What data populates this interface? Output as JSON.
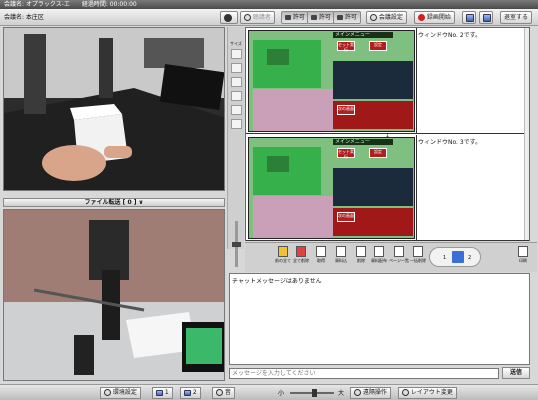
{
  "titlebar": {
    "meeting_label": "会議名: オプラックス-エ",
    "elapsed_label": "経過時間: 00:00:00"
  },
  "toolbar": {
    "meeting_name": "会議名: 本庄区",
    "audience_label": "聴講者",
    "permit1_label": "許可",
    "permit2_label": "許可",
    "permit3_label": "許可",
    "settings_label": "会議設定",
    "record_label": "録画開始",
    "exit_label": "退室する"
  },
  "file_transfer": {
    "label": "ファイル転送 [ 0 ] ∨"
  },
  "document": {
    "caption1": "ウィンドウNo. 2です。",
    "caption2": "ウィンドウNo. 3です。",
    "page_divider": "1",
    "mini_title": "メインメニュー",
    "mini_btn1": "セット実行",
    "mini_btn2": "設定",
    "mini_btn3": "次の画面"
  },
  "doc_tools": {
    "prev_all": "前の全て",
    "delete_all": "全て削除",
    "tool1": "取得",
    "tool2": "資料込",
    "tool3": "削除",
    "tool4": "資料配布",
    "tool5": "ページ一覧",
    "tool6": "一括削除",
    "tool7": "印刷",
    "page_left": "1",
    "page_right": "2"
  },
  "palette": {
    "size_label": "サイズ"
  },
  "chat": {
    "log_message": "チャットメッセージはありません",
    "input_placeholder": "メッセージを入力してください",
    "send_label": "送信"
  },
  "bottombar": {
    "env_settings": "環境設定",
    "cam1": "1",
    "cam2": "2",
    "sound_label": "音",
    "volume_low": "小",
    "volume_high": "大",
    "volume_level": 0.55,
    "remote_label": "遠隔操作",
    "layout_label": "レイアウト変更"
  },
  "colors": {
    "accent_red": "#d02020",
    "slide_green": "#35b04a"
  }
}
